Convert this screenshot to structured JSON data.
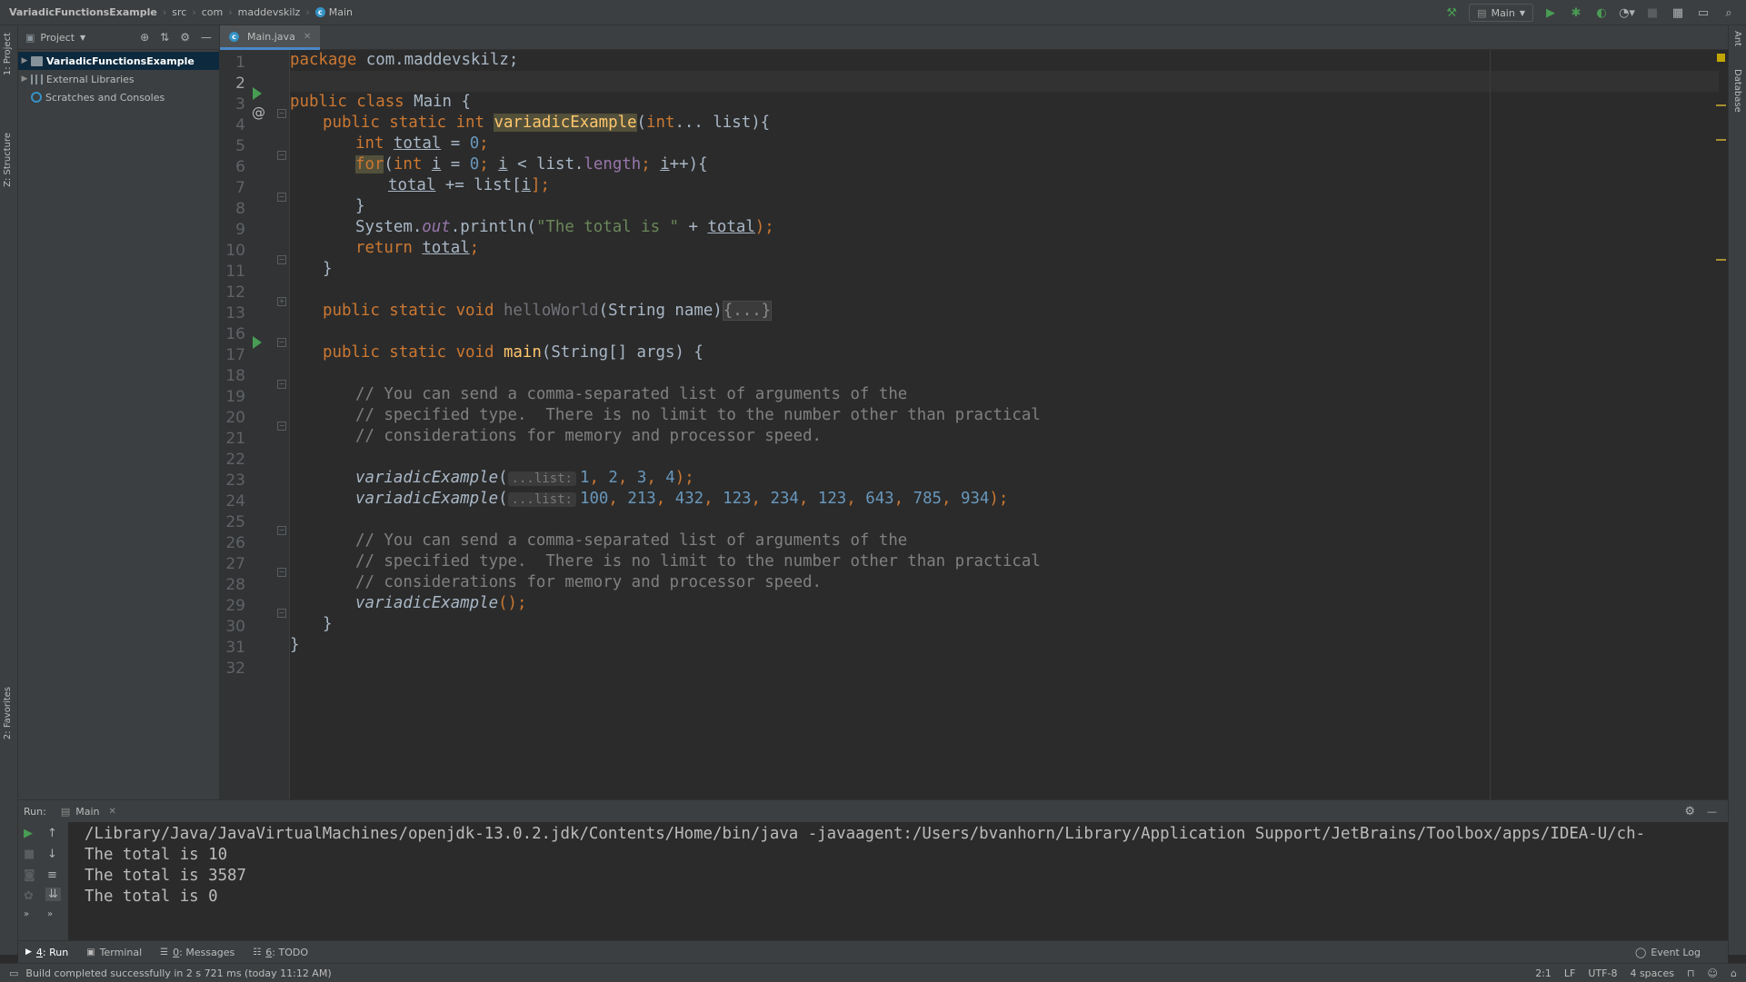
{
  "navbar": {
    "breadcrumbs": [
      "VariadicFunctionsExample",
      "src",
      "com",
      "maddevskilz",
      "Main"
    ],
    "run_config": "Main"
  },
  "left_strip": {
    "tabs": [
      "1: Project",
      "Z: Structure",
      "2: Favorites"
    ]
  },
  "right_strip": {
    "tabs": [
      "Ant",
      "Database"
    ]
  },
  "project_panel": {
    "title": "Project",
    "items": [
      {
        "label": "VariadicFunctionsExample",
        "selected": true
      },
      {
        "label": "External Libraries",
        "selected": false
      },
      {
        "label": "Scratches and Consoles",
        "selected": false
      }
    ]
  },
  "editor": {
    "tab": "Main.java",
    "line_numbers": [
      "1",
      "2",
      "3",
      "4",
      "5",
      "6",
      "7",
      "8",
      "9",
      "10",
      "11",
      "12",
      "13",
      "16",
      "17",
      "18",
      "19",
      "20",
      "21",
      "22",
      "23",
      "24",
      "25",
      "26",
      "27",
      "28",
      "29",
      "30",
      "31",
      "32"
    ],
    "code": {
      "l1_kw": "package",
      "l1_rest": " com.maddevskilz;",
      "l3_kw": "public class",
      "l3_rest": " Main {",
      "l4_kw": "public static int",
      "l4_fn": "variadicExample",
      "l4_p1": "(",
      "l4_kw2": "int",
      "l4_rest": "... list){",
      "l5_kw": "int",
      "l5_var": "total",
      "l5_mid": " = ",
      "l5_num": "0",
      "l5_end": ";",
      "l6_for": "for",
      "l6_p": "(",
      "l6_kw": "int",
      "l6_i": "i",
      "l6_eq": " = ",
      "l6_num": "0",
      "l6_semi": "; ",
      "l6_i2": "i",
      "l6_lt": " < list.",
      "l6_len": "length",
      "l6_semi2": "; ",
      "l6_i3": "i",
      "l6_end": "++){",
      "l7_var": "total",
      "l7_mid": " += list[",
      "l7_i": "i",
      "l7_end": "];",
      "l8": "}",
      "l9_a": "System.",
      "l9_out": "out",
      "l9_b": ".println(",
      "l9_str": "\"The total is \"",
      "l9_c": " + ",
      "l9_var": "total",
      "l9_end": ");",
      "l10_kw": "return",
      "l10_var": "total",
      "l10_end": ";",
      "l11": "}",
      "l13_kw": "public static void",
      "l13_fn": "helloWorld",
      "l13_rest": "(String name)",
      "l13_fold": "{...}",
      "l17_kw": "public static void",
      "l17_fn": "main",
      "l17_rest": "(String[] args) {",
      "l19": "// You can send a comma-separated list of arguments of the",
      "l20": "// specified type.  There is no limit to the number other than practical",
      "l21": "// considerations for memory and processor speed.",
      "l23_fn": "variadicExample",
      "l23_p": "(",
      "l23_hint": "...list:",
      "l23_n1": "1",
      "l23_n2": "2",
      "l23_n3": "3",
      "l23_n4": "4",
      "l23_end": ");",
      "l24_fn": "variadicExample",
      "l24_p": "(",
      "l24_hint": "...list:",
      "l24_nums": [
        "100",
        "213",
        "432",
        "123",
        "234",
        "123",
        "643",
        "785",
        "934"
      ],
      "l24_end": ");",
      "l26": "// You can send a comma-separated list of arguments of the",
      "l27": "// specified type.  There is no limit to the number other than practical",
      "l28": "// considerations for memory and processor speed.",
      "l29_fn": "variadicExample",
      "l29_end": "();",
      "l30": "}",
      "l31": "}"
    }
  },
  "run_panel": {
    "label": "Run:",
    "tab": "Main",
    "console": [
      "/Library/Java/JavaVirtualMachines/openjdk-13.0.2.jdk/Contents/Home/bin/java -javaagent:/Users/bvanhorn/Library/Application Support/JetBrains/Toolbox/apps/IDEA-U/ch-",
      "The total is 10",
      "The total is 3587",
      "The total is 0"
    ]
  },
  "bottom_tabs": [
    {
      "num": "4",
      "label": ": Run",
      "active": true
    },
    {
      "num": "",
      "label": "Terminal",
      "active": false
    },
    {
      "num": "0",
      "label": ": Messages",
      "active": false
    },
    {
      "num": "6",
      "label": ": TODO",
      "active": false
    }
  ],
  "event_log": "Event Log",
  "status": {
    "message": "Build completed successfully in 2 s 721 ms (today 11:12 AM)",
    "position": "2:1",
    "line_sep": "LF",
    "encoding": "UTF-8",
    "indent": "4 spaces"
  },
  "colors": {
    "background": "#2b2b2b",
    "keyword": "#cc7832",
    "function": "#ffc66d",
    "number": "#6897bb",
    "string": "#6a8759",
    "comment": "#808080",
    "run_green": "#499c54"
  }
}
